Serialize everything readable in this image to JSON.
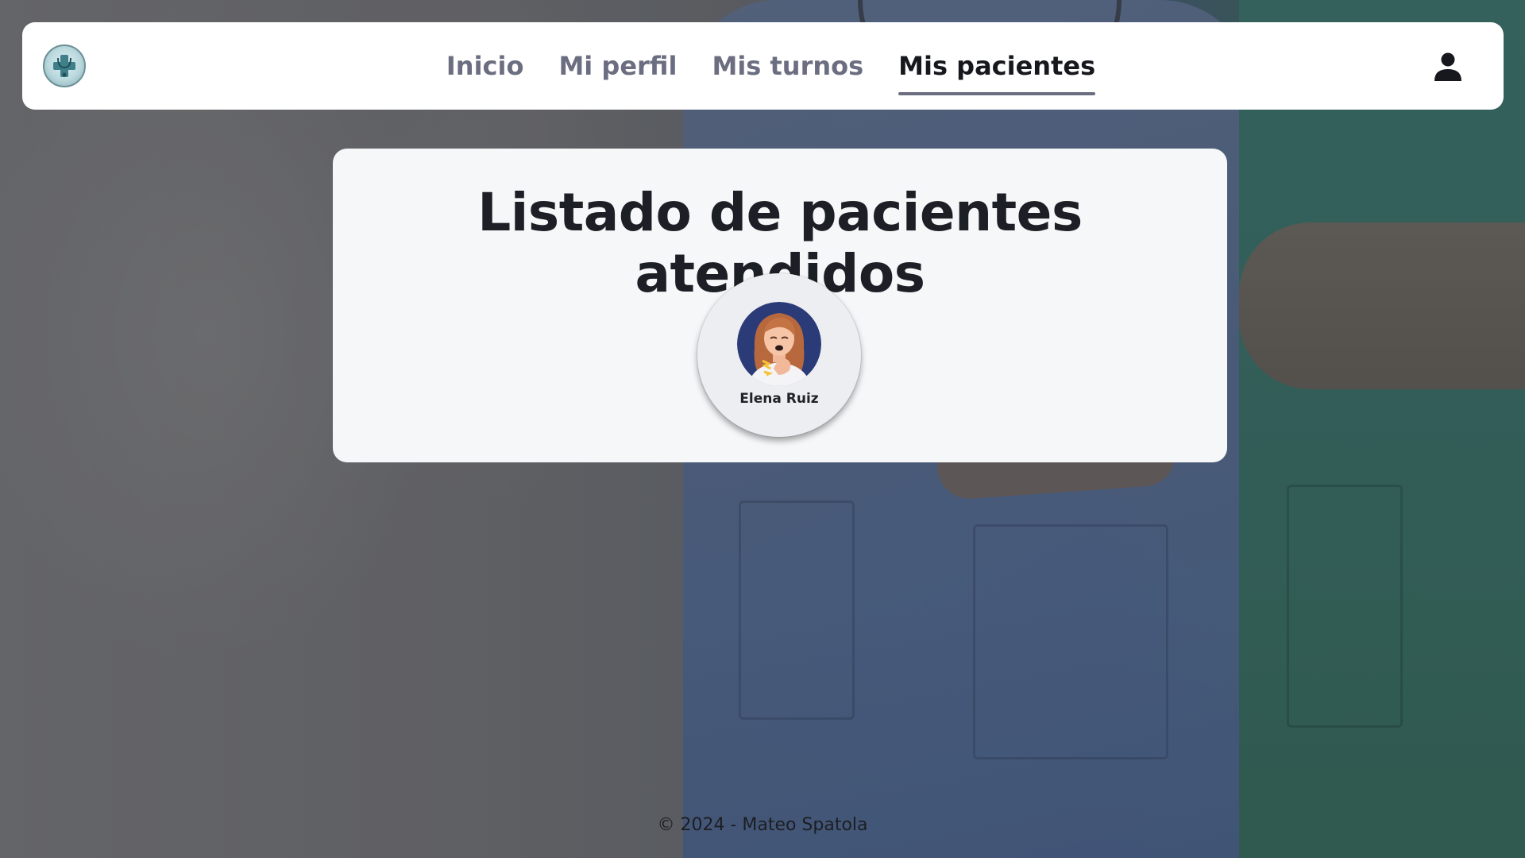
{
  "nav": {
    "logo_icon": "medical-logo-icon",
    "links": [
      {
        "label": "Inicio",
        "active": false
      },
      {
        "label": "Mi perfil",
        "active": false
      },
      {
        "label": "Mis turnos",
        "active": false
      },
      {
        "label": "Mis pacientes",
        "active": true
      }
    ],
    "user_icon": "user-icon"
  },
  "main": {
    "title": "Listado de pacientes atendidos",
    "patients": [
      {
        "name": "Elena Ruiz",
        "avatar_icon": "patient-avatar-icon"
      }
    ]
  },
  "footer": {
    "text": "© 2024 - Mateo Spatola"
  },
  "colors": {
    "nav_inactive": "#6b6e80",
    "nav_active": "#16181d",
    "card_bg": "#f6f7f9",
    "avatar_bg": "#2b3b78"
  }
}
